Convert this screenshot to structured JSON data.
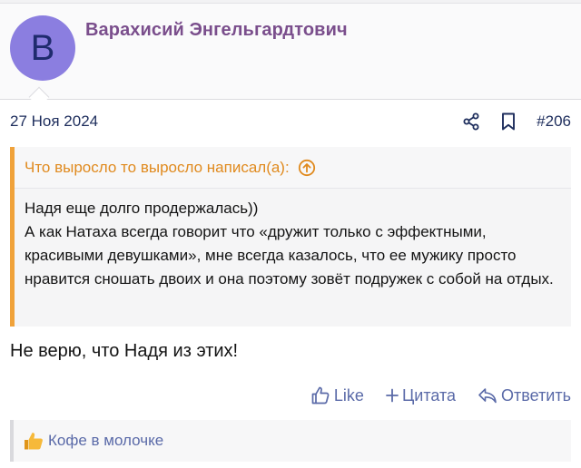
{
  "post": {
    "author": {
      "avatar_letter": "В",
      "name": "Варахисий Энгельгардтович"
    },
    "date": "27 Ноя 2024",
    "number": "#206",
    "quote": {
      "header": "Что выросло то выросло написал(а):",
      "lines": [
        "Надя еще долго продержалась))",
        "А как Натаха всегда говорит что «дружит только с эффектными, красивыми девушками», мне всегда казалось, что ее мужику просто нравится сношать двоих и она поэтому зовёт подружек с собой на отдых."
      ]
    },
    "message": "Не верю, что Надя из этих!",
    "actions": {
      "like": "Like",
      "quote": "Цитата",
      "reply": "Ответить"
    },
    "reactions": {
      "icon": "thumbs-up-emoji",
      "users": "Кофе в молочке"
    }
  },
  "colors": {
    "accent": "#7a4e8c",
    "link": "#5a6aa8",
    "quote_border": "#f0a23a",
    "quote_author": "#e08a1e",
    "avatar_bg": "#8b7ee0"
  }
}
